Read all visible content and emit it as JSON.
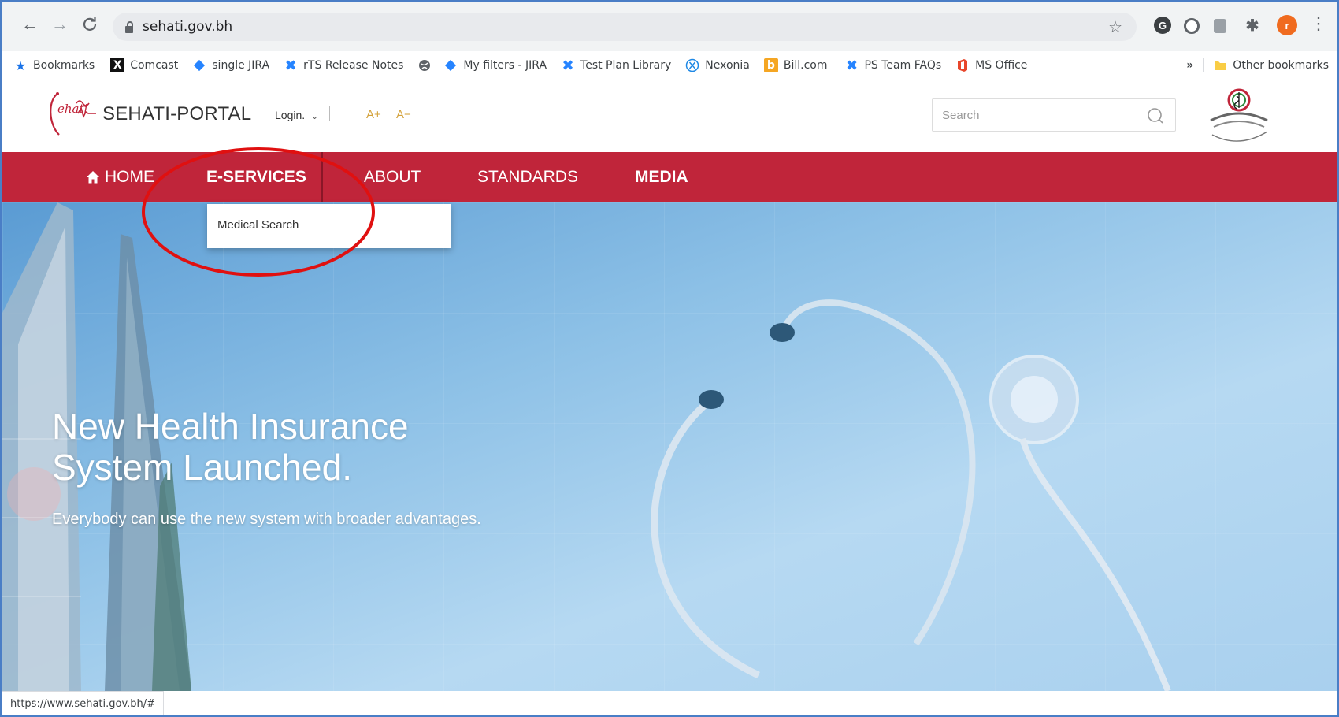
{
  "browser": {
    "url": "sehati.gov.bh",
    "status_url": "https://www.sehati.gov.bh/#",
    "profile_initial": "r"
  },
  "bookmarks_bar": {
    "items": [
      {
        "label": "Bookmarks",
        "icon": "star-icon"
      },
      {
        "label": "Comcast",
        "icon": "x-icon"
      },
      {
        "label": "single JIRA",
        "icon": "jira-icon"
      },
      {
        "label": "rTS Release Notes",
        "icon": "confluence-icon"
      },
      {
        "label": "",
        "icon": "globe-icon"
      },
      {
        "label": "My filters - JIRA",
        "icon": "jira-icon"
      },
      {
        "label": "Test Plan Library",
        "icon": "confluence-icon"
      },
      {
        "label": "Nexonia",
        "icon": "nexonia-icon"
      },
      {
        "label": "Bill.com",
        "icon": "bill-icon"
      },
      {
        "label": "PS Team FAQs",
        "icon": "confluence-icon"
      },
      {
        "label": "MS Office",
        "icon": "office-icon"
      }
    ],
    "overflow": "»",
    "other": "Other bookmarks"
  },
  "site": {
    "portal_name": "SEHATI-PORTAL",
    "login": "Login.",
    "font_increase": "A+",
    "font_decrease": "A−",
    "search_placeholder": "Search"
  },
  "nav": {
    "home": "HOME",
    "eservices": "E-SERVICES",
    "about": "ABOUT",
    "standards": "STANDARDS",
    "media": "MEDIA"
  },
  "dropdown": {
    "item": "Medical Search"
  },
  "hero": {
    "title": "New Health Insurance\nSystem Launched.",
    "subtitle": "Everybody can use the new system with broader advantages."
  },
  "colors": {
    "brand_red": "#c0253a",
    "gold": "#d4a23a",
    "annotation_red": "#e01010"
  }
}
